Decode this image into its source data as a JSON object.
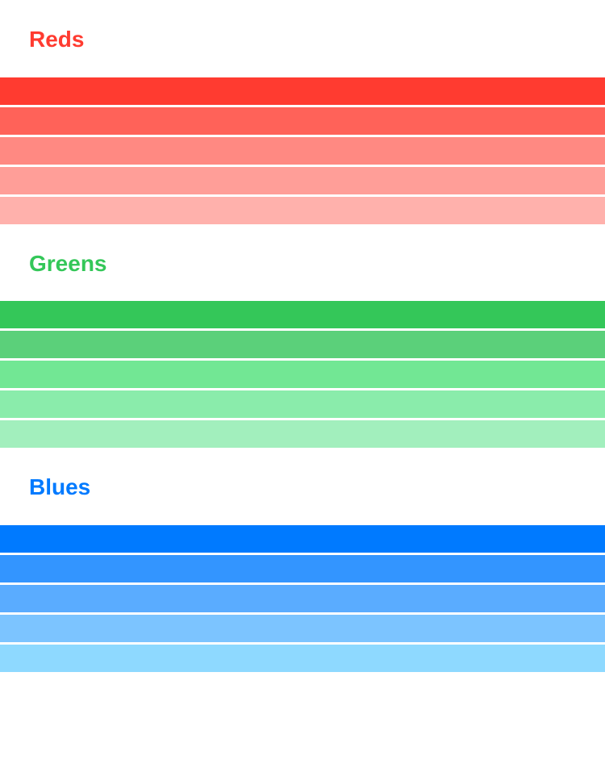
{
  "sections": [
    {
      "id": "reds",
      "label": "Reds",
      "label_color": "#ff3b30",
      "swatches": [
        "#ff3b30",
        "#ff6259",
        "#ff8982",
        "#ff9e98",
        "#ffb1ac"
      ]
    },
    {
      "id": "greens",
      "label": "Greens",
      "label_color": "#34c759",
      "swatches": [
        "#34c759",
        "#5bd07a",
        "#72e794",
        "#8aecab",
        "#a2efbd"
      ]
    },
    {
      "id": "blues",
      "label": "Blues",
      "label_color": "#007aff",
      "swatches": [
        "#007aff",
        "#3395ff",
        "#5aacff",
        "#7cc4ff",
        "#8ed9ff"
      ]
    }
  ]
}
